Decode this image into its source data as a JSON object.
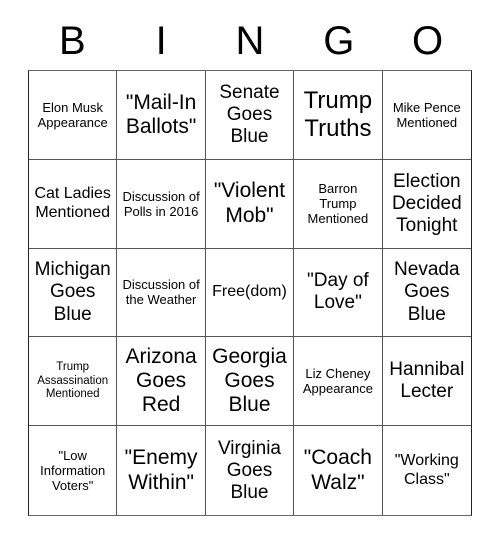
{
  "header": {
    "letters": [
      "B",
      "I",
      "N",
      "G",
      "O"
    ]
  },
  "grid": {
    "rows": [
      [
        {
          "text": "Elon Musk Appearance",
          "size": "sz-s"
        },
        {
          "text": "\"Mail-In Ballots\"",
          "size": "sz-xl"
        },
        {
          "text": "Senate Goes Blue",
          "size": "sz-l"
        },
        {
          "text": "Trump Truths",
          "size": "sz-xxl"
        },
        {
          "text": "Mike Pence Mentioned",
          "size": "sz-s"
        }
      ],
      [
        {
          "text": "Cat Ladies Mentioned",
          "size": "sz-m"
        },
        {
          "text": "Discussion of Polls in 2016",
          "size": "sz-s"
        },
        {
          "text": "\"Violent Mob\"",
          "size": "sz-xl"
        },
        {
          "text": "Barron Trump Mentioned",
          "size": "sz-s"
        },
        {
          "text": "Election Decided Tonight",
          "size": "sz-l"
        }
      ],
      [
        {
          "text": "Michigan Goes Blue",
          "size": "sz-l"
        },
        {
          "text": "Discussion of the Weather",
          "size": "sz-s"
        },
        {
          "text": "Free(dom)",
          "size": "sz-m"
        },
        {
          "text": "\"Day of Love\"",
          "size": "sz-l"
        },
        {
          "text": "Nevada Goes Blue",
          "size": "sz-l"
        }
      ],
      [
        {
          "text": "Trump Assassination Mentioned",
          "size": "sz-xs"
        },
        {
          "text": "Arizona Goes Red",
          "size": "sz-xl"
        },
        {
          "text": "Georgia Goes Blue",
          "size": "sz-xl"
        },
        {
          "text": "Liz Cheney Appearance",
          "size": "sz-s"
        },
        {
          "text": "Hannibal Lecter",
          "size": "sz-l"
        }
      ],
      [
        {
          "text": "\"Low Information Voters\"",
          "size": "sz-s"
        },
        {
          "text": "\"Enemy Within\"",
          "size": "sz-xl"
        },
        {
          "text": "Virginia Goes Blue",
          "size": "sz-l"
        },
        {
          "text": "\"Coach Walz\"",
          "size": "sz-xl"
        },
        {
          "text": "\"Working Class\"",
          "size": "sz-m"
        }
      ]
    ]
  }
}
